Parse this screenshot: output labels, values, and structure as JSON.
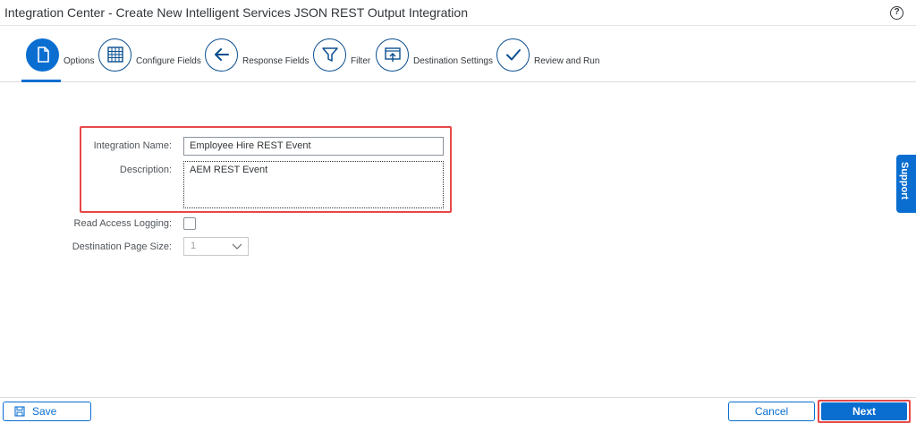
{
  "window": {
    "title": "Integration Center - Create New Intelligent Services JSON REST Output Integration",
    "help_icon": "?"
  },
  "steps": [
    {
      "label": "Options",
      "icon": "document-icon",
      "active": true
    },
    {
      "label": "Configure Fields",
      "icon": "table-icon",
      "active": false
    },
    {
      "label": "Response Fields",
      "icon": "arrow-left-icon",
      "active": false
    },
    {
      "label": "Filter",
      "icon": "filter-icon",
      "active": false
    },
    {
      "label": "Destination Settings",
      "icon": "upload-screen-icon",
      "active": false
    },
    {
      "label": "Review and Run",
      "icon": "checkmark-icon",
      "active": false
    }
  ],
  "form": {
    "integration_name_label": "Integration Name:",
    "integration_name_value": "Employee Hire REST Event",
    "description_label": "Description:",
    "description_value": "AEM REST Event",
    "read_access_logging_label": "Read Access Logging:",
    "read_access_logging_checked": false,
    "destination_page_size_label": "Destination Page Size:",
    "destination_page_size_value": "1"
  },
  "support_tab": {
    "label": "Support"
  },
  "footer": {
    "save_label": "Save",
    "cancel_label": "Cancel",
    "next_label": "Next"
  },
  "colors": {
    "accent": "#0a6ed1",
    "highlight": "#e64848"
  }
}
